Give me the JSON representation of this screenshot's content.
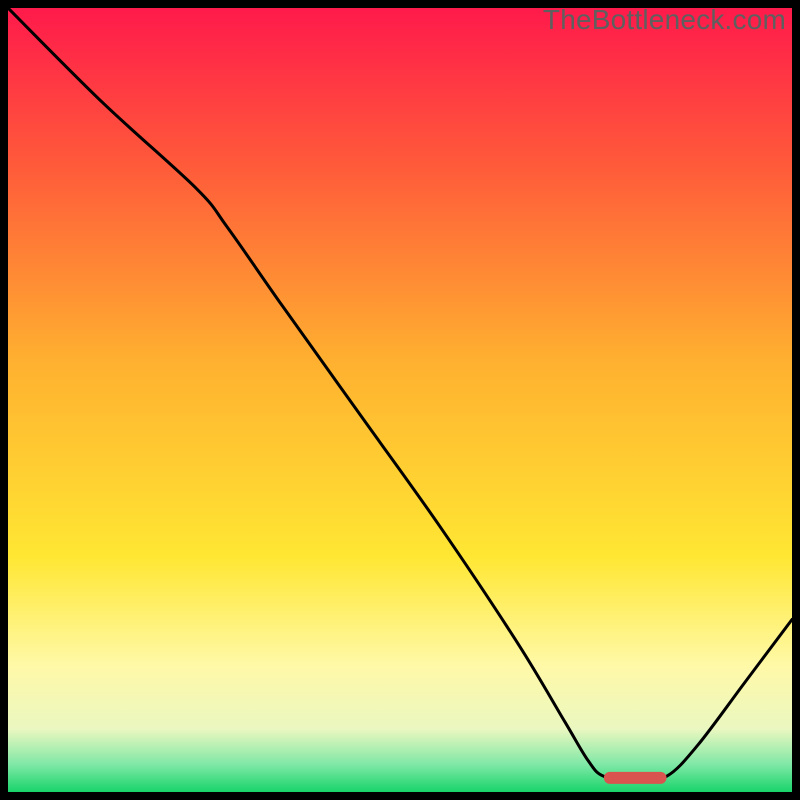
{
  "watermark": "TheBottleneck.com",
  "chart_data": {
    "type": "line",
    "title": "",
    "xlabel": "",
    "ylabel": "",
    "xlim": [
      0,
      100
    ],
    "ylim": [
      0,
      100
    ],
    "background_gradient": {
      "stops": [
        {
          "pos": 0.0,
          "color": "#ff1a4b"
        },
        {
          "pos": 0.2,
          "color": "#ff5a3a"
        },
        {
          "pos": 0.45,
          "color": "#ffb030"
        },
        {
          "pos": 0.7,
          "color": "#ffe733"
        },
        {
          "pos": 0.84,
          "color": "#fff9a8"
        },
        {
          "pos": 0.92,
          "color": "#eaf7c0"
        },
        {
          "pos": 0.965,
          "color": "#7fe8a6"
        },
        {
          "pos": 1.0,
          "color": "#18d46a"
        }
      ]
    },
    "series": [
      {
        "name": "bottleneck-curve",
        "color": "#000000",
        "points": [
          {
            "x": 0.0,
            "y": 100.0
          },
          {
            "x": 12.0,
            "y": 88.0
          },
          {
            "x": 24.0,
            "y": 77.0
          },
          {
            "x": 28.0,
            "y": 72.0
          },
          {
            "x": 35.0,
            "y": 62.0
          },
          {
            "x": 45.0,
            "y": 48.0
          },
          {
            "x": 55.0,
            "y": 34.0
          },
          {
            "x": 65.0,
            "y": 19.0
          },
          {
            "x": 71.0,
            "y": 9.0
          },
          {
            "x": 74.0,
            "y": 4.0
          },
          {
            "x": 76.0,
            "y": 2.0
          },
          {
            "x": 80.0,
            "y": 1.5
          },
          {
            "x": 84.0,
            "y": 2.0
          },
          {
            "x": 88.0,
            "y": 6.0
          },
          {
            "x": 94.0,
            "y": 14.0
          },
          {
            "x": 100.0,
            "y": 22.0
          }
        ]
      }
    ],
    "marker": {
      "name": "optimal-range",
      "color": "#d9534f",
      "x_start": 76.0,
      "x_end": 84.0,
      "y": 1.8
    }
  }
}
